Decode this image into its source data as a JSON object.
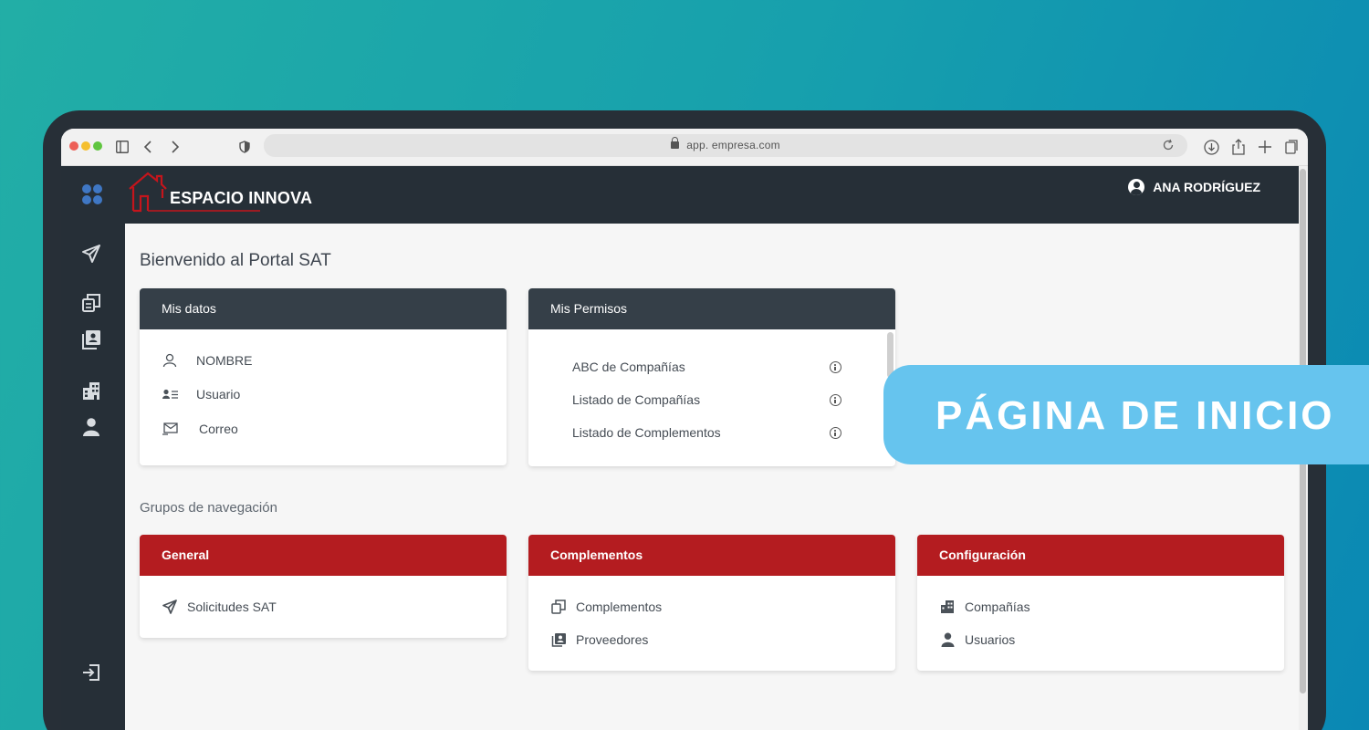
{
  "browser": {
    "url": "app. empresa.com"
  },
  "header": {
    "brand": "ESPACIO INNOVA",
    "user_name": "ANA RODRÍGUEZ"
  },
  "sidebar": {
    "icons": [
      "paper-plane-icon",
      "copy-icon",
      "contact-book-icon",
      "building-icon",
      "user-icon",
      "logout-icon"
    ]
  },
  "main": {
    "title": "Bienvenido al Portal SAT",
    "mis_datos": {
      "title": "Mis datos",
      "rows": [
        "NOMBRE",
        "Usuario",
        "Correo"
      ]
    },
    "mis_permisos": {
      "title": "Mis Permisos",
      "rows": [
        "ABC de Compañías",
        "Listado de Compañías",
        "Listado de Complementos"
      ]
    },
    "nav_groups_title": "Grupos de navegación",
    "groups": [
      {
        "title": "General",
        "items": [
          "Solicitudes SAT"
        ]
      },
      {
        "title": "Complementos",
        "items": [
          "Complementos",
          "Proveedores"
        ]
      },
      {
        "title": "Configuración",
        "items": [
          "Compañías",
          "Usuarios"
        ]
      }
    ]
  },
  "banner": {
    "text": "PÁGINA DE INICIO"
  },
  "colors": {
    "header": "#262f37",
    "card_header_dark": "#353f48",
    "card_header_red": "#b41c20",
    "banner": "#66c4ee"
  }
}
